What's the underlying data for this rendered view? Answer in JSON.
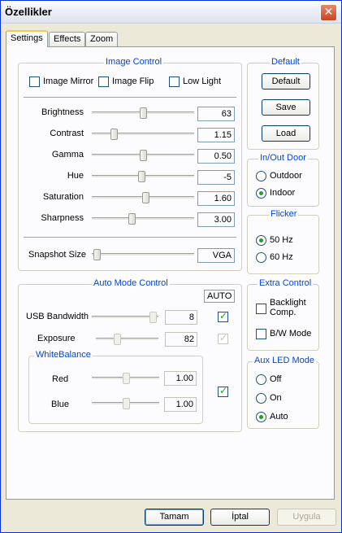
{
  "window": {
    "title": "Özellikler"
  },
  "tabs": [
    {
      "label": "Settings"
    },
    {
      "label": "Effects"
    },
    {
      "label": "Zoom"
    }
  ],
  "image_control": {
    "title": "Image Control",
    "image_mirror": {
      "label": "Image Mirror",
      "checked": false
    },
    "image_flip": {
      "label": "Image Flip",
      "checked": false
    },
    "low_light": {
      "label": "Low Light",
      "checked": false
    },
    "sliders": [
      {
        "label": "Brightness",
        "value": "63",
        "level": 0.5
      },
      {
        "label": "Contrast",
        "value": "1.15",
        "level": 0.18
      },
      {
        "label": "Gamma",
        "value": "0.50",
        "level": 0.5
      },
      {
        "label": "Hue",
        "value": "-5",
        "level": 0.48
      },
      {
        "label": "Saturation",
        "value": "1.60",
        "level": 0.53
      },
      {
        "label": "Sharpness",
        "value": "3.00",
        "level": 0.38
      }
    ],
    "snapshot": {
      "label": "Snapshot Size",
      "value": "VGA",
      "level": 0.0
    }
  },
  "default_group": {
    "title": "Default",
    "buttons": [
      "Default",
      "Save",
      "Load"
    ]
  },
  "inout_door": {
    "title": "In/Out Door",
    "options": [
      {
        "label": "Outdoor",
        "checked": false
      },
      {
        "label": "Indoor",
        "checked": true
      }
    ]
  },
  "flicker": {
    "title": "Flicker",
    "options": [
      {
        "label": "50 Hz",
        "checked": true
      },
      {
        "label": "60 Hz",
        "checked": false
      }
    ]
  },
  "auto_mode": {
    "title": "Auto Mode Control",
    "auto_label": "AUTO",
    "usb_bandwidth": {
      "label": "USB Bandwidth",
      "value": "8",
      "level": 0.98,
      "auto": true
    },
    "exposure": {
      "label": "Exposure",
      "value": "82",
      "level": 0.3,
      "auto": true,
      "auto_disabled": true
    },
    "white_balance": {
      "title": "WhiteBalance",
      "red": {
        "label": "Red",
        "value": "1.00",
        "level": 0.5
      },
      "blue": {
        "label": "Blue",
        "value": "1.00",
        "level": 0.5
      },
      "auto": true
    }
  },
  "extra_control": {
    "title": "Extra Control",
    "backlight": {
      "label_line1": "Backlight",
      "label_line2": "Comp.",
      "checked": false
    },
    "bw_mode": {
      "label": "B/W Mode",
      "checked": false
    }
  },
  "aux_led": {
    "title": "Aux LED Mode",
    "options": [
      {
        "label": "Off",
        "checked": false
      },
      {
        "label": "On",
        "checked": false
      },
      {
        "label": "Auto",
        "checked": true
      }
    ]
  },
  "footer": {
    "ok": "Tamam",
    "cancel": "İptal",
    "apply": "Uygula"
  },
  "colors": {
    "group_title": "#0046d5",
    "check_green": "#21a121",
    "window_border": "#0831d9"
  }
}
